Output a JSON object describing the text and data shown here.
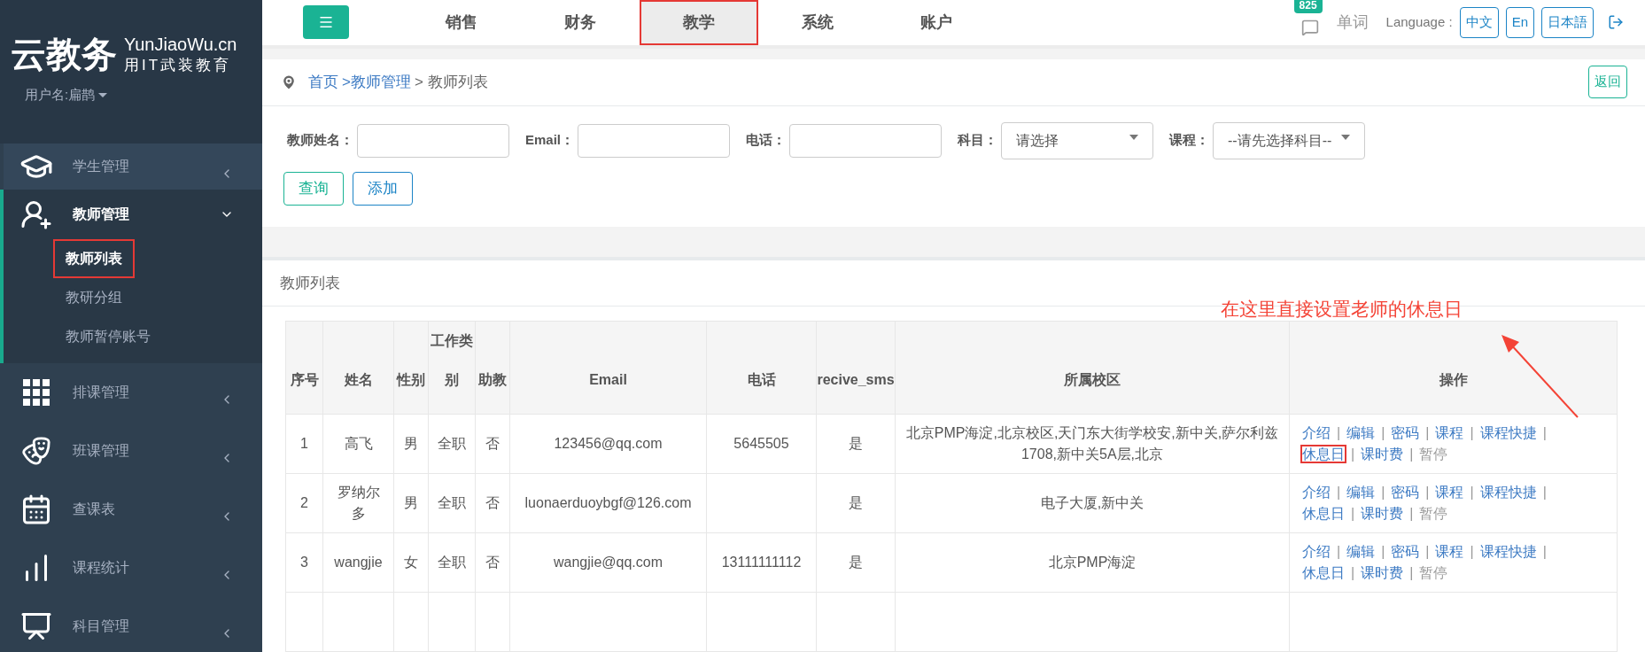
{
  "logo": {
    "title": "云教务",
    "subtitle": "YunJiaoWu.cn",
    "slogan": "用IT武装教育"
  },
  "user": {
    "label": "用户名:扁鹊"
  },
  "sidebar": {
    "items": [
      {
        "label": "学生管理",
        "expanded": false
      },
      {
        "label": "教师管理",
        "expanded": true,
        "children": [
          {
            "label": "教师列表",
            "selected": true
          },
          {
            "label": "教研分组",
            "selected": false
          },
          {
            "label": "教师暂停账号",
            "selected": false
          }
        ]
      },
      {
        "label": "排课管理",
        "expanded": false
      },
      {
        "label": "班课管理",
        "expanded": false
      },
      {
        "label": "查课表",
        "expanded": false
      },
      {
        "label": "课程统计",
        "expanded": false
      },
      {
        "label": "科目管理",
        "expanded": false
      }
    ]
  },
  "top_tabs": [
    {
      "label": "销售",
      "selected": false
    },
    {
      "label": "财务",
      "selected": false
    },
    {
      "label": "教学",
      "selected": true
    },
    {
      "label": "系统",
      "selected": false
    },
    {
      "label": "账户",
      "selected": false
    }
  ],
  "notifications": {
    "count": "825"
  },
  "words_link": "单词",
  "language": {
    "label": "Language :",
    "options": [
      {
        "label": "中文"
      },
      {
        "label": "En"
      },
      {
        "label": "日本語"
      }
    ]
  },
  "breadcrumb": {
    "home": "首页",
    "separator": ">",
    "parent": "教师管理",
    "current": "> 教师列表"
  },
  "back_button": "返回",
  "filters": [
    {
      "label": "教师姓名：",
      "kind": "input"
    },
    {
      "label": "Email：",
      "kind": "input"
    },
    {
      "label": "电话：",
      "kind": "input"
    },
    {
      "label": "科目：",
      "kind": "select",
      "value": "请选择"
    },
    {
      "label": "课程：",
      "kind": "select",
      "value": "--请先选择科目--"
    }
  ],
  "buttons": [
    {
      "label": "查询",
      "kind": "primary"
    },
    {
      "label": "添加",
      "kind": "info"
    }
  ],
  "panel_title": "教师列表",
  "annotation": "在这里直接设置老师的休息日",
  "table": {
    "columns": [
      "序号",
      "姓名",
      "性别",
      "工作类别",
      "助教",
      "Email",
      "电话",
      "recive_sms",
      "所属校区",
      "操作"
    ],
    "separator": "|",
    "rows": [
      {
        "cells": [
          "1",
          "高飞",
          "男",
          "全职",
          "否",
          "123456@qq.com",
          "5645505",
          "是",
          "北京PMP海淀,北京校区,天门东大街学校安,新中关,萨尔利兹1708,新中关5A层,北京"
        ],
        "actions": [
          {
            "label": "介绍",
            "disabled": false
          },
          {
            "label": "编辑",
            "disabled": false
          },
          {
            "label": "密码",
            "disabled": false
          },
          {
            "label": "课程",
            "disabled": false
          },
          {
            "label": "课程快捷",
            "disabled": false
          },
          {
            "label": "休息日",
            "disabled": false
          },
          {
            "label": "课时费",
            "disabled": false
          },
          {
            "label": "暂停",
            "disabled": true
          }
        ]
      },
      {
        "cells": [
          "2",
          "罗纳尔多",
          "男",
          "全职",
          "否",
          "luonaerduoybgf@126.com",
          "",
          "是",
          "电子大厦,新中关"
        ],
        "actions": [
          {
            "label": "介绍",
            "disabled": false
          },
          {
            "label": "编辑",
            "disabled": false
          },
          {
            "label": "密码",
            "disabled": false
          },
          {
            "label": "课程",
            "disabled": false
          },
          {
            "label": "课程快捷",
            "disabled": false
          },
          {
            "label": "休息日",
            "disabled": false
          },
          {
            "label": "课时费",
            "disabled": false
          },
          {
            "label": "暂停",
            "disabled": true
          }
        ]
      },
      {
        "cells": [
          "3",
          "wangjie",
          "女",
          "全职",
          "否",
          "wangjie@qq.com",
          "13111111112",
          "是",
          "北京PMP海淀"
        ],
        "actions": [
          {
            "label": "介绍",
            "disabled": false
          },
          {
            "label": "编辑",
            "disabled": false
          },
          {
            "label": "密码",
            "disabled": false
          },
          {
            "label": "课程",
            "disabled": false
          },
          {
            "label": "课程快捷",
            "disabled": false
          },
          {
            "label": "休息日",
            "disabled": false
          },
          {
            "label": "课时费",
            "disabled": false
          },
          {
            "label": "暂停",
            "disabled": true
          }
        ]
      }
    ]
  }
}
